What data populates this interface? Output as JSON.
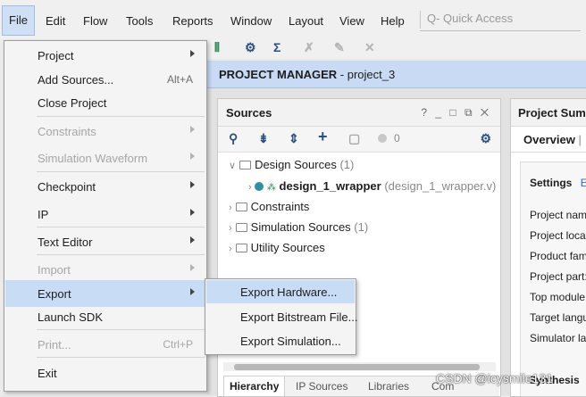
{
  "menubar": {
    "items": [
      {
        "label": "File",
        "active": true
      },
      {
        "label": "Edit"
      },
      {
        "label": "Flow"
      },
      {
        "label": "Tools"
      },
      {
        "label": "Reports"
      },
      {
        "label": "Window"
      },
      {
        "label": "Layout"
      },
      {
        "label": "View"
      },
      {
        "label": "Help"
      }
    ],
    "quick_access": "Q- Quick Access"
  },
  "project_manager": {
    "title_bold": "PROJECT MANAGER",
    "title_rest": " - project_3"
  },
  "sources": {
    "title": "Sources",
    "controls": "? _ □ ⧉ ✕",
    "error_count": "0",
    "tree": {
      "design_sources": {
        "label": "Design Sources",
        "count": "(1)"
      },
      "top": {
        "name": "design_1_wrapper",
        "file": "(design_1_wrapper.v) (1)"
      },
      "constraints": {
        "label": "Constraints"
      },
      "simulation": {
        "label": "Simulation Sources",
        "count": "(1)"
      },
      "utility": {
        "label": "Utility Sources"
      }
    },
    "bottom_tabs": [
      "Hierarchy",
      "IP Sources",
      "Libraries",
      "Com"
    ]
  },
  "summary": {
    "title": "Project Summ",
    "tab": "Overview",
    "tab_sep": "|",
    "settings": "Settings",
    "settings_link": "E",
    "labels": [
      "Project name",
      "Project locat",
      "Product fam",
      "Project part:",
      "Top module",
      "Target langu",
      "Simulator lan"
    ],
    "synthesis": "Synthesis"
  },
  "file_menu": {
    "items": [
      {
        "label": "Project",
        "submenu": true
      },
      {
        "label": "Add Sources...",
        "shortcut": "Alt+A"
      },
      {
        "label": "Close Project"
      },
      {
        "label": "Constraints",
        "submenu": true,
        "disabled": true
      },
      {
        "label": "Simulation Waveform",
        "submenu": true,
        "disabled": true
      },
      {
        "label": "Checkpoint",
        "submenu": true
      },
      {
        "label": "IP",
        "submenu": true
      },
      {
        "label": "Text Editor",
        "submenu": true
      },
      {
        "label": "Import",
        "submenu": true,
        "disabled": true
      },
      {
        "label": "Export",
        "submenu": true,
        "highlighted": true
      },
      {
        "label": "Launch SDK"
      },
      {
        "label": "Print...",
        "shortcut": "Ctrl+P",
        "disabled": true
      },
      {
        "label": "Exit"
      }
    ]
  },
  "export_submenu": {
    "items": [
      {
        "label": "Export Hardware...",
        "highlighted": true
      },
      {
        "label": "Export Bitstream File..."
      },
      {
        "label": "Export Simulation..."
      }
    ]
  },
  "watermark": "CSDN @icysmile131",
  "colors": {
    "highlight": "#c9dcf5",
    "header_blue": "#c9dbf4",
    "accent_blue": "#2a4f82"
  }
}
